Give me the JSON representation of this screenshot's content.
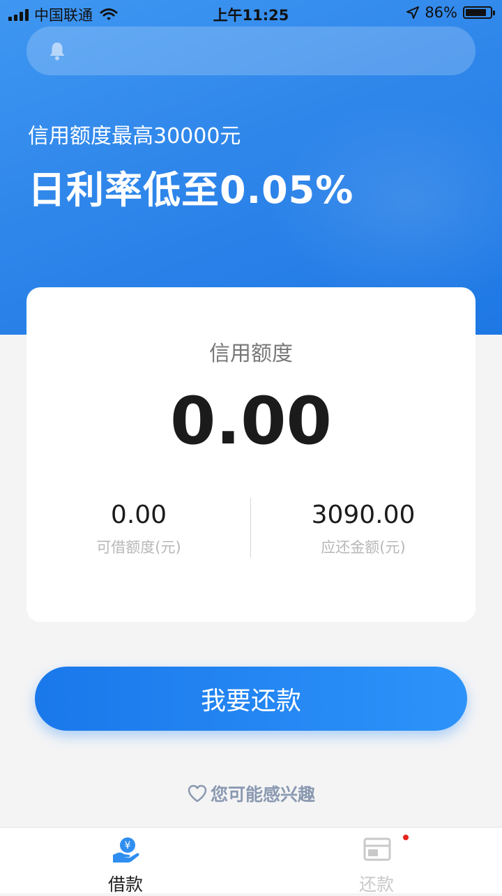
{
  "status_bar": {
    "carrier": "中国联通",
    "time": "上午11:25",
    "battery_percent": "86%",
    "battery_level": 0.86
  },
  "notice": {
    "icon": "bell-icon"
  },
  "promo": {
    "subtitle": "信用额度最高30000元",
    "headline": "日利率低至0.05%"
  },
  "credit_card": {
    "title": "信用额度",
    "amount": "0.00",
    "available": {
      "value": "0.00",
      "label": "可借额度(元)"
    },
    "due": {
      "value": "3090.00",
      "label": "应还金额(元)"
    }
  },
  "repay_button": {
    "label": "我要还款"
  },
  "interest": {
    "label": "您可能感兴趣",
    "icon": "heart-outline-icon"
  },
  "tab_bar": {
    "tabs": [
      {
        "label": "借款",
        "icon": "hand-yen-icon",
        "active": true
      },
      {
        "label": "还款",
        "icon": "bill-card-icon",
        "active": false,
        "badge": "dot"
      }
    ]
  },
  "colors": {
    "primary": "#2f86ea",
    "button_start": "#1a78ea",
    "button_end": "#2d93fa",
    "badge": "#e8241d",
    "background": "#f4f4f5"
  }
}
